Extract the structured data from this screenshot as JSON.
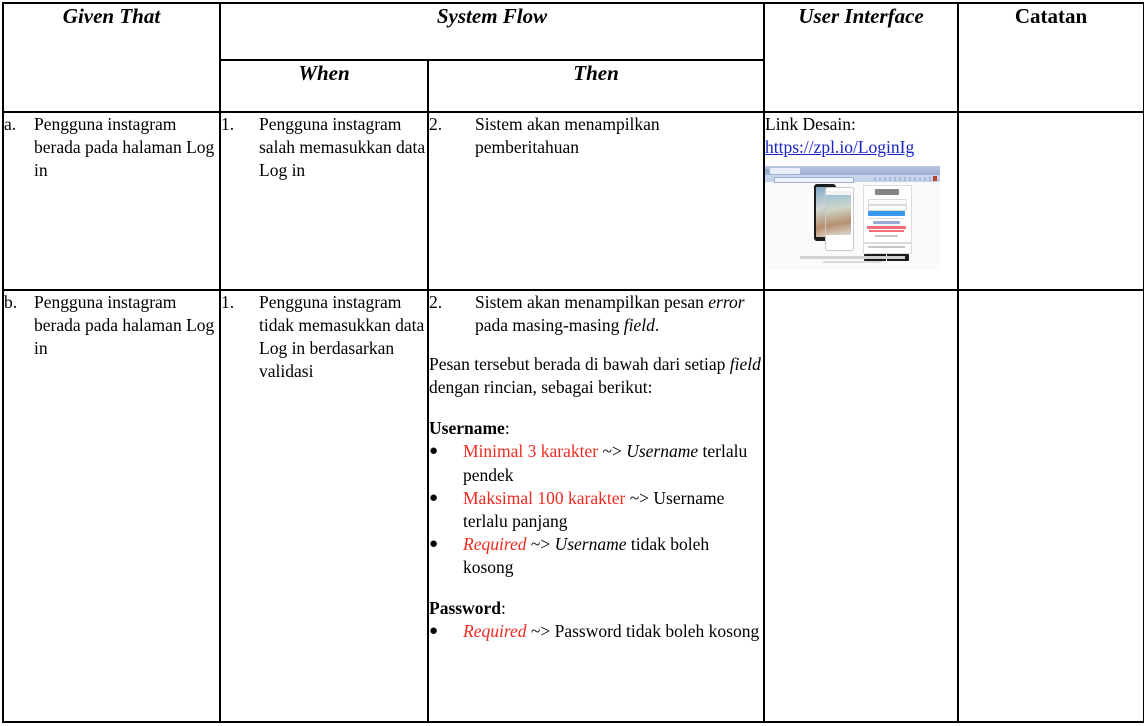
{
  "table": {
    "headers": {
      "given_that": "Given That",
      "system_flow": "System Flow",
      "when": "When",
      "then": "Then",
      "user_interface": "User Interface",
      "catatan": "Catatan"
    },
    "rows": [
      {
        "given": {
          "marker": "a.",
          "text": "Pengguna instagram berada pada halaman Log in"
        },
        "when": {
          "marker": "1.",
          "text": "Pengguna instagram salah memasukkan data Log in"
        },
        "then": {
          "marker": "2.",
          "text": "Sistem akan menampilkan pemberitahuan"
        },
        "ui": {
          "link_label": "Link Desain:",
          "link_text": "https://zpl.io/LoginIg",
          "thumbnail_alt": "instagram-login-design-preview"
        },
        "catatan": ""
      },
      {
        "given": {
          "marker": "b.",
          "text": "Pengguna instagram berada pada halaman Log in"
        },
        "when": {
          "marker": "1.",
          "text": "Pengguna instagram tidak memasukkan data Log in berdasarkan validasi"
        },
        "then": {
          "marker": "2.",
          "lead_1": "Sistem akan menampilkan pesan ",
          "lead_em": "error",
          "lead_2": " pada masing-masing ",
          "lead_em2": "field",
          "lead_3": ".",
          "para_1": "Pesan tersebut berada di bawah dari setiap ",
          "para_em": "field",
          "para_2": " dengan rincian, sebagai berikut:",
          "sections": [
            {
              "title": "Username",
              "colon": ":",
              "bullet_char": "●",
              "rules": [
                {
                  "red": "Minimal 3 karakter",
                  "arrow": " ~> ",
                  "em": "Username",
                  "rest": " terlalu pendek"
                },
                {
                  "red": "Maksimal 100 karakter",
                  "arrow": " ~> ",
                  "em": "",
                  "rest": "Username terlalu panjang"
                },
                {
                  "red_em": "Required",
                  "arrow": " ~> ",
                  "em": "Username",
                  "rest": " tidak boleh kosong"
                }
              ]
            },
            {
              "title": "Password",
              "colon": ":",
              "bullet_char": "●",
              "rules": [
                {
                  "red_em": "Required",
                  "arrow": " ~> ",
                  "em": "",
                  "rest": "Password tidak boleh kosong"
                }
              ]
            }
          ]
        },
        "ui": {
          "link_label": "",
          "link_text": ""
        },
        "catatan": ""
      }
    ]
  },
  "colors": {
    "error_red": "#ef2b20",
    "link_blue": "#1a24c4",
    "border": "#000000",
    "ig_button_blue": "#3897f0"
  }
}
